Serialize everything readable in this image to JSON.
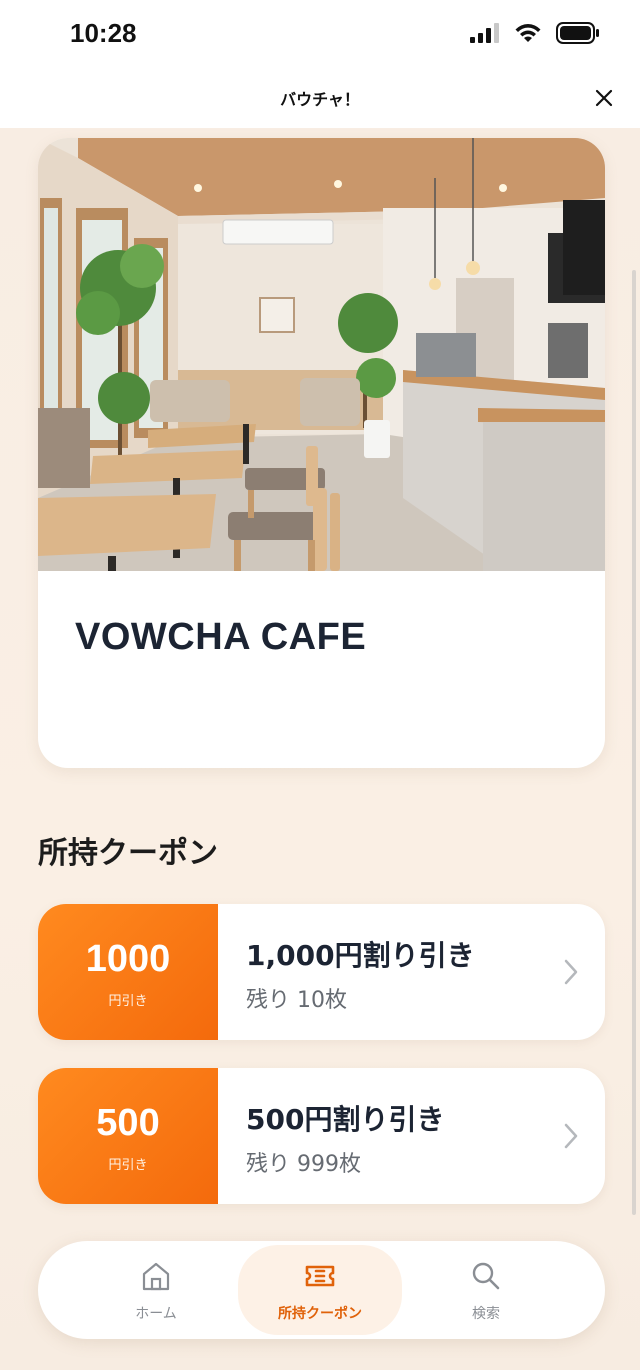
{
  "status_bar": {
    "time": "10:28"
  },
  "header": {
    "title": "バウチャ！"
  },
  "store": {
    "name": "VOWCHA CAFE"
  },
  "coupons_section": {
    "title": "所持クーポン"
  },
  "coupons": [
    {
      "amount": "1000",
      "unit": "円引き",
      "title": "1,000円割り引き",
      "remaining": "残り 10枚"
    },
    {
      "amount": "500",
      "unit": "円引き",
      "title": "500円割り引き",
      "remaining": "残り 999枚"
    }
  ],
  "bottom_nav": {
    "items": [
      {
        "label": "ホーム",
        "icon": "home-icon"
      },
      {
        "label": "所持クーポン",
        "icon": "ticket-icon",
        "active": true
      },
      {
        "label": "検索",
        "icon": "search-icon"
      }
    ]
  },
  "colors": {
    "accent": "#f46a0c",
    "background": "#f8ede3"
  }
}
